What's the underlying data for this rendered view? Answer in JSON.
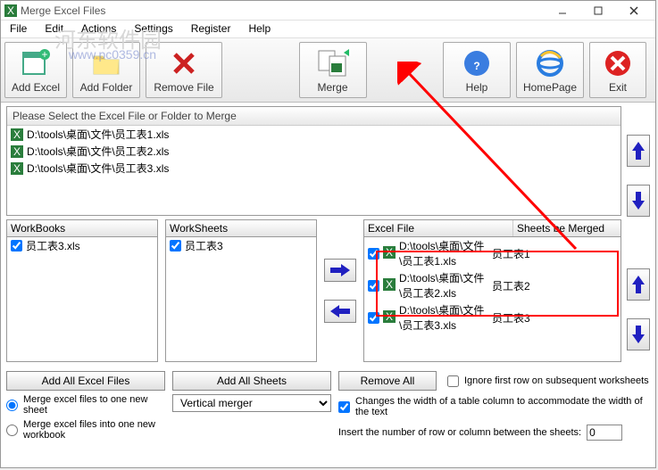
{
  "title": "Merge Excel Files",
  "watermark_text": "河东软件园",
  "watermark_link": "www.pc0359.cn",
  "menus": [
    "File",
    "Edit",
    "Actions",
    "Settings",
    "Register",
    "Help"
  ],
  "toolbar": {
    "add_excel": "Add Excel",
    "add_folder": "Add Folder",
    "remove_file": "Remove File",
    "merge": "Merge",
    "help": "Help",
    "homepage": "HomePage",
    "exit": "Exit"
  },
  "file_section_label": "Please Select the Excel File or Folder to Merge",
  "files": [
    "D:\\tools\\桌面\\文件\\员工表1.xls",
    "D:\\tools\\桌面\\文件\\员工表2.xls",
    "D:\\tools\\桌面\\文件\\员工表3.xls"
  ],
  "workbooks_label": "WorkBooks",
  "workbooks": [
    "员工表3.xls"
  ],
  "worksheets_label": "WorkSheets",
  "worksheets": [
    "员工表3"
  ],
  "excel_file_label": "Excel File",
  "sheets_merged_label": "Sheets be Merged",
  "merge_rows": [
    {
      "file": "D:\\tools\\桌面\\文件\\员工表1.xls",
      "sheet": "员工表1"
    },
    {
      "file": "D:\\tools\\桌面\\文件\\员工表2.xls",
      "sheet": "员工表2"
    },
    {
      "file": "D:\\tools\\桌面\\文件\\员工表3.xls",
      "sheet": "员工表3"
    }
  ],
  "buttons": {
    "add_all_excel": "Add All Excel Files",
    "add_all_sheets": "Add All Sheets",
    "remove_all": "Remove All"
  },
  "radios": {
    "one_sheet": "Merge excel files to one new sheet",
    "one_workbook": "Merge excel files into one new workbook"
  },
  "merge_mode_option": "Vertical merger",
  "checkboxes": {
    "ignore_first": "Ignore first row on subsequent worksheets",
    "change_width": "Changes the width of a table column to accommodate the width of the text"
  },
  "row_insert_label": "Insert the number of row or column between the sheets:",
  "row_insert_value": "0"
}
